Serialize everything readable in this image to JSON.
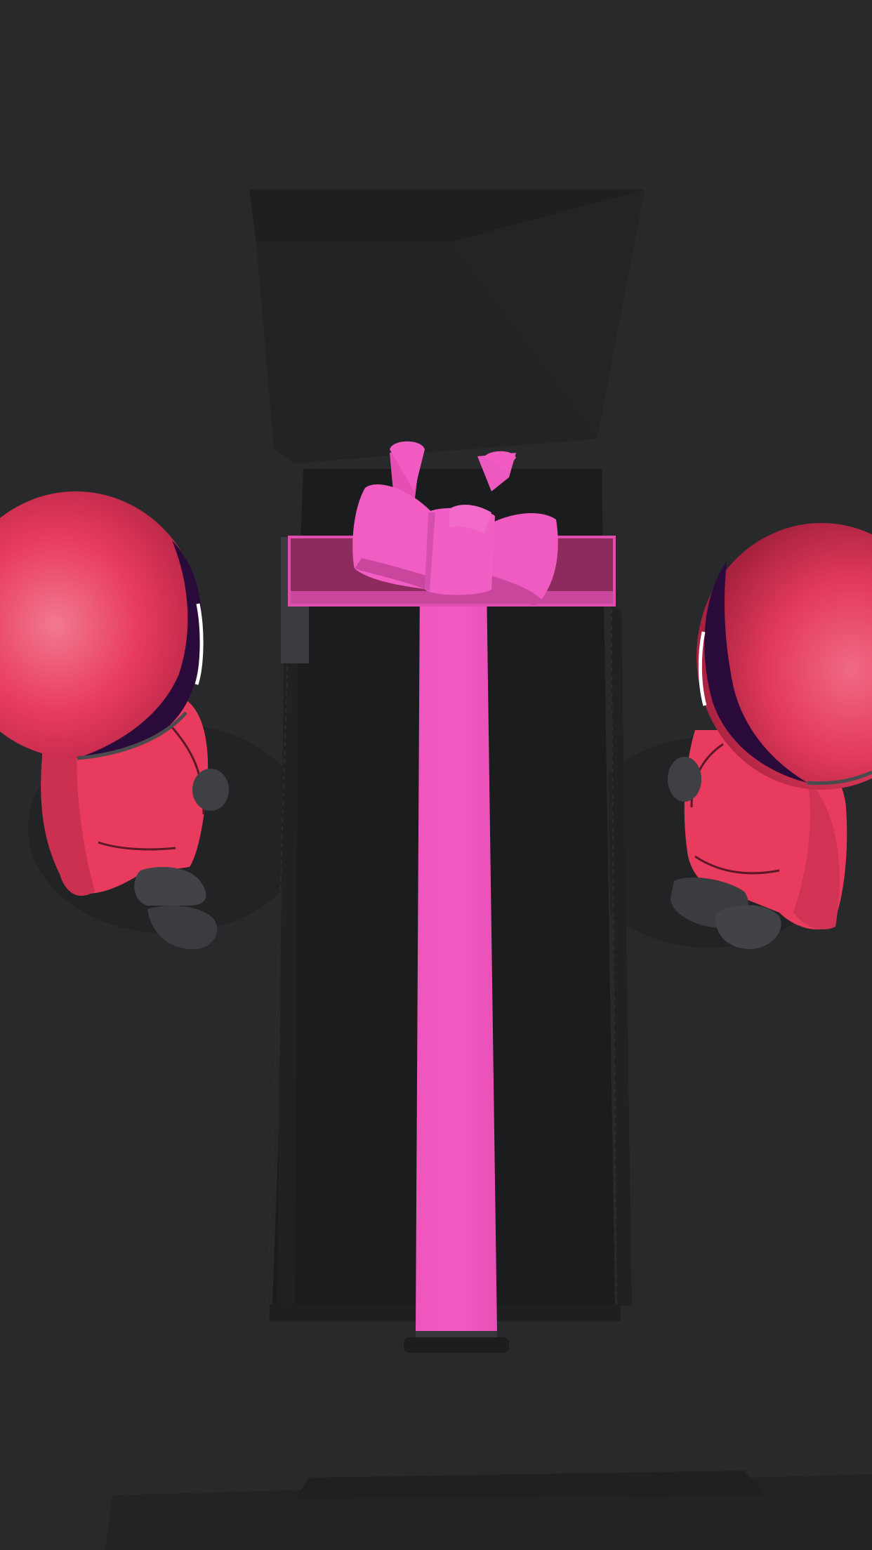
{
  "scene": {
    "kind": "3d-game-viewport",
    "objects": [
      "gift-box",
      "ribbon-bow",
      "guard-left",
      "guard-right"
    ],
    "colors": {
      "floor": "#28292b",
      "shadow": "#1d1e20",
      "gift_box": "#1b1c1e",
      "ribbon": "#f157bf",
      "ribbon_dark": "#c9469d",
      "ribbon_band_top": "#8d2a5e",
      "guard_suit": "#e83b5d",
      "guard_mask": "#2a0a3a"
    }
  }
}
